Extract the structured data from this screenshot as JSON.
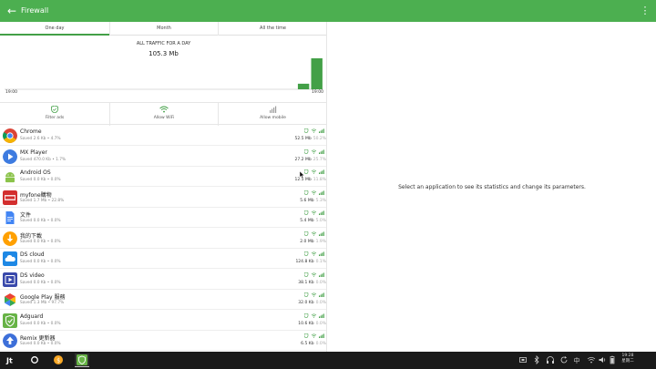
{
  "appbar": {
    "title": "Firewall",
    "back_icon": "arrow-left-icon",
    "menu_icon": "more-vert-icon"
  },
  "tabs": [
    {
      "label": "One day"
    },
    {
      "label": "Month"
    },
    {
      "label": "All the time"
    }
  ],
  "chart": {
    "title": "ALL TRAFFIC FOR A DAY",
    "total": "105.3 Mb",
    "x_start_label": "19:00",
    "x_end_label": "19:00"
  },
  "chart_data": {
    "type": "bar",
    "title": "ALL TRAFFIC FOR A DAY",
    "xlabel": "",
    "ylabel": "",
    "x_tick_labels": [
      "19:00",
      "19:00"
    ],
    "values": [
      0,
      0,
      0,
      0,
      0,
      0,
      0,
      0,
      0,
      0,
      0,
      0,
      0,
      0,
      0,
      0,
      0,
      0,
      0,
      0,
      0,
      0,
      0.18,
      1.0
    ],
    "ylim": [
      0,
      1
    ],
    "bar_color": "#43a047",
    "grid": false
  },
  "toggles": [
    {
      "label": "Filter ads",
      "icon": "shield-icon"
    },
    {
      "label": "Allow WiFi",
      "icon": "wifi-icon"
    },
    {
      "label": "Allow mobile",
      "icon": "signal-bars-icon"
    }
  ],
  "apps": [
    {
      "name": "Chrome",
      "stats": "Saved 2.6 Kb • 4.7%",
      "traffic": "52.5 Mb",
      "percent": "50.2%",
      "icon": "chrome-icon"
    },
    {
      "name": "MX Player",
      "stats": "Saved 470.0 Kb • 1.7%",
      "traffic": "27.2 Mb",
      "percent": "25.7%",
      "icon": "mx-player-icon"
    },
    {
      "name": "Android OS",
      "stats": "Saved 0.0 Kb • 0.0%",
      "traffic": "12.5 Mb",
      "percent": "11.8%",
      "icon": "android-icon"
    },
    {
      "name": "myfone購物",
      "stats": "Saved 1.7 Mb • 22.8%",
      "traffic": "5.6 Mb",
      "percent": "5.3%",
      "icon": "myfone-icon"
    },
    {
      "name": "文件",
      "stats": "Saved 0.0 Kb • 0.0%",
      "traffic": "5.4 Mb",
      "percent": "5.0%",
      "icon": "docs-icon"
    },
    {
      "name": "我的下載",
      "stats": "Saved 0.0 Kb • 0.0%",
      "traffic": "2.0 Mb",
      "percent": "1.9%",
      "icon": "download-icon"
    },
    {
      "name": "DS cloud",
      "stats": "Saved 0.0 Kb • 0.0%",
      "traffic": "124.8 Kb",
      "percent": "0.1%",
      "icon": "ds-cloud-icon"
    },
    {
      "name": "DS video",
      "stats": "Saved 0.0 Kb • 0.0%",
      "traffic": "38.1 Kb",
      "percent": "0.0%",
      "icon": "ds-video-icon"
    },
    {
      "name": "Google Play 服務",
      "stats": "Saved 1.3 Mb • 97.7%",
      "traffic": "32.0 Kb",
      "percent": "0.0%",
      "icon": "google-play-services-icon"
    },
    {
      "name": "Adguard",
      "stats": "Saved 0.0 Kb • 0.0%",
      "traffic": "10.6 Kb",
      "percent": "0.0%",
      "icon": "adguard-icon"
    },
    {
      "name": "Remix 更新器",
      "stats": "Saved 0.0 Kb • 0.0%",
      "traffic": "6.5 Kb",
      "percent": "0.0%",
      "icon": "remix-updater-icon"
    }
  ],
  "right_pane": {
    "message": "Select an application to see its statistics and change its parameters."
  },
  "taskbar": {
    "clock_time": "19:28",
    "clock_day": "星期二",
    "items": [
      "remix-start-icon",
      "home-circle-icon",
      "coin-app-icon",
      "adguard-app-icon"
    ],
    "tray": [
      "screenshot-icon",
      "bluetooth-icon",
      "headset-icon",
      "refresh-icon",
      "ime-icon",
      "wifi-icon",
      "volume-icon",
      "battery-icon"
    ]
  },
  "colors": {
    "accent": "#4caf50",
    "bar": "#43a047",
    "taskbar": "#1a1a1a"
  }
}
